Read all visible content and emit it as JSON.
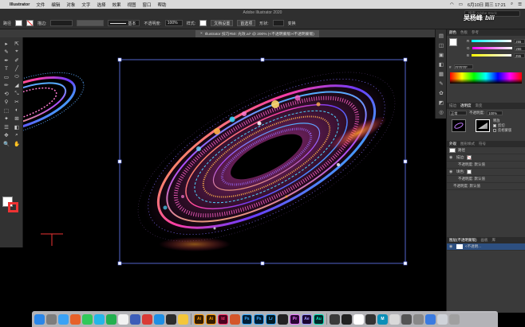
{
  "menubar": {
    "app_name": "Illustrator",
    "items": [
      "文件",
      "编辑",
      "对象",
      "文字",
      "选择",
      "效果",
      "视图",
      "窗口",
      "帮助"
    ],
    "right_icons": [
      "battery-icon",
      "wifi-icon",
      "search-icon",
      "control-center-icon"
    ],
    "clock": "6月10日 周三 17:21"
  },
  "control": {
    "window_title": "Adobe Illustrator 2020",
    "left_label": "路径",
    "stroke_label": "描边:",
    "brush_label": "基本",
    "opacity_label": "不透明度:",
    "opacity_value": "100%",
    "style_label": "样式:",
    "doc_setup": "文档设置",
    "preferences": "首选项",
    "shape_label": "形状:",
    "transform": "变换",
    "search_placeholder": "搜索 Adobe Stock"
  },
  "doctab": {
    "title": "Illustrator 技巧#50: 光效.ai* @ 200% (<不透明蒙版>/不透明蒙版)"
  },
  "tools": [
    "▸",
    "⇱",
    "✎",
    "⌖",
    "✒",
    "✐",
    "T",
    "╱",
    "▭",
    "⬭",
    "✏",
    "◢",
    "⟲",
    "⤡",
    "⚲",
    "✂",
    "⬚",
    "◐",
    "✦",
    "⊞",
    "☰",
    "◧",
    "✥",
    "⌕",
    "🔍",
    "✋"
  ],
  "color_panel": {
    "tabs": [
      "颜色",
      "色板",
      "参考"
    ],
    "channels": [
      {
        "name": "R",
        "value": "255"
      },
      {
        "name": "G",
        "value": "255"
      },
      {
        "name": "B",
        "value": "255"
      }
    ],
    "hex": "FFFFFF"
  },
  "transparency_panel": {
    "tabs": [
      "描边",
      "透明度",
      "渐变"
    ],
    "mode": "正常",
    "opacity_label": "不透明度:",
    "opacity_value": "100%",
    "release": "释放",
    "clip": "剪切",
    "invert": "反相蒙版"
  },
  "appearance_panel": {
    "tabs": [
      "外观",
      "图形样式",
      "符号"
    ],
    "rows": [
      {
        "label": "路径"
      },
      {
        "label": "描边:"
      },
      {
        "label": "不透明度: 默认值"
      },
      {
        "label": "填色:"
      },
      {
        "label": "不透明度: 默认值"
      },
      {
        "label": "不透明度: 默认值"
      }
    ]
  },
  "layers_panel": {
    "tabs": [
      "图层(不透明蒙版)",
      "画板",
      "库"
    ],
    "row": "<不透明..."
  },
  "watermark": {
    "name": "吴杨峰",
    "logo": "bili"
  },
  "dock": [
    {
      "label": "",
      "color": "#2a86e8"
    },
    {
      "label": "",
      "color": "#7d7d7d"
    },
    {
      "label": "",
      "color": "#3aa2f5"
    },
    {
      "label": "",
      "color": "#e6612a"
    },
    {
      "label": "",
      "color": "#30c95a"
    },
    {
      "label": "",
      "color": "#25b5e9"
    },
    {
      "label": "",
      "color": "#23b04f"
    },
    {
      "label": "",
      "color": "#f2f2f2"
    },
    {
      "label": "",
      "color": "#3c5db8"
    },
    {
      "label": "",
      "color": "#d93b36"
    },
    {
      "label": "",
      "color": "#1e8fe4"
    },
    {
      "label": "",
      "color": "#2c2c2c"
    },
    {
      "label": "",
      "color": "#f4c63a"
    },
    {
      "label": "Ai",
      "color": "#331c00"
    },
    {
      "label": "Ai",
      "color": "#331c00"
    },
    {
      "label": "Id",
      "color": "#49021f"
    },
    {
      "label": "",
      "color": "#d4562a"
    },
    {
      "label": "Ps",
      "color": "#001e36"
    },
    {
      "label": "Ps",
      "color": "#001e36"
    },
    {
      "label": "Lr",
      "color": "#001a24"
    },
    {
      "label": "",
      "color": "#222"
    },
    {
      "label": "Pr",
      "color": "#2a0634"
    },
    {
      "label": "Ae",
      "color": "#1a0530"
    },
    {
      "label": "Au",
      "color": "#002829"
    },
    {
      "label": "",
      "color": "#3b3b3b"
    },
    {
      "label": "",
      "color": "#222"
    },
    {
      "label": "",
      "color": "#ffffff"
    },
    {
      "label": "",
      "color": "#333"
    },
    {
      "label": "M",
      "color": "#0a8fb8"
    },
    {
      "label": "",
      "color": "#d9d9d9"
    },
    {
      "label": "",
      "color": "#555"
    },
    {
      "label": "",
      "color": "#888"
    },
    {
      "label": "",
      "color": "#3a7be0"
    },
    {
      "label": "",
      "color": "#cfd3d9"
    },
    {
      "label": "",
      "color": "#a0a0a0"
    }
  ]
}
